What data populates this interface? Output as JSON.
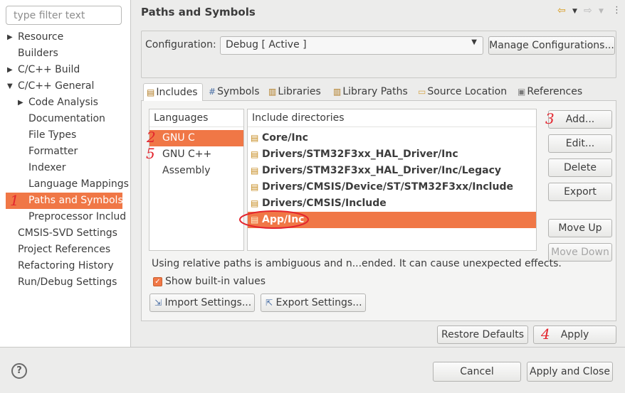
{
  "filter": {
    "placeholder": "type filter text"
  },
  "nav": {
    "items": [
      {
        "label": "Resource",
        "expandable": true,
        "expanded": false
      },
      {
        "label": "Builders"
      },
      {
        "label": "C/C++ Build",
        "expandable": true,
        "expanded": false
      },
      {
        "label": "C/C++ General",
        "expandable": true,
        "expanded": true
      },
      {
        "label": "Code Analysis",
        "expandable": true,
        "expanded": false
      },
      {
        "label": "Documentation"
      },
      {
        "label": "File Types"
      },
      {
        "label": "Formatter"
      },
      {
        "label": "Indexer"
      },
      {
        "label": "Language Mappings"
      },
      {
        "label": "Paths and Symbols",
        "selected": true
      },
      {
        "label": "Preprocessor Includ"
      },
      {
        "label": "CMSIS-SVD Settings"
      },
      {
        "label": "Project References"
      },
      {
        "label": "Refactoring History"
      },
      {
        "label": "Run/Debug Settings"
      }
    ]
  },
  "header": {
    "title": "Paths and Symbols",
    "icons": [
      "back-arrow-icon",
      "dropdown-icon",
      "forward-arrow-icon",
      "dropdown-icon",
      "view-menu-icon"
    ]
  },
  "configuration": {
    "label": "Configuration:",
    "value": "Debug  [ Active ]",
    "manage_button": "Manage Configurations..."
  },
  "tabs": [
    {
      "label": "Includes",
      "icon": "includes-icon",
      "active": true
    },
    {
      "label": "Symbols",
      "icon": "hash-icon"
    },
    {
      "label": "Libraries",
      "icon": "library-icon"
    },
    {
      "label": "Library Paths",
      "icon": "library-paths-icon"
    },
    {
      "label": "Source Location",
      "icon": "source-folder-icon"
    },
    {
      "label": "References",
      "icon": "references-icon"
    }
  ],
  "languages": {
    "header": "Languages",
    "items": [
      {
        "label": "GNU C",
        "selected": true
      },
      {
        "label": "GNU C++"
      },
      {
        "label": "Assembly"
      }
    ]
  },
  "includes": {
    "header": "Include directories",
    "items": [
      {
        "label": "Core/Inc"
      },
      {
        "label": "Drivers/STM32F3xx_HAL_Driver/Inc"
      },
      {
        "label": "Drivers/STM32F3xx_HAL_Driver/Inc/Legacy"
      },
      {
        "label": "Drivers/CMSIS/Device/ST/STM32F3xx/Include"
      },
      {
        "label": "Drivers/CMSIS/Include"
      },
      {
        "label": "App/Inc",
        "selected": true
      }
    ]
  },
  "side_buttons": {
    "add": "Add...",
    "edit": "Edit...",
    "delete": "Delete",
    "export": "Export",
    "move_up": "Move Up",
    "move_down": "Move Down"
  },
  "warning": "Using relative paths is ambiguous and n...ended. It can cause unexpected effects.",
  "show_builtin": {
    "label": "Show built-in values",
    "checked": true
  },
  "import_settings": "Import Settings...",
  "export_settings": "Export Settings...",
  "restore_defaults": "Restore Defaults",
  "apply": "Apply",
  "cancel": "Cancel",
  "apply_and_close": "Apply and Close",
  "annotations": {
    "step1": "1",
    "step2": "2",
    "step3": "3",
    "step4": "4",
    "step5": "5"
  },
  "colors": {
    "selection": "#f07746",
    "annotation": "#e3252e"
  }
}
